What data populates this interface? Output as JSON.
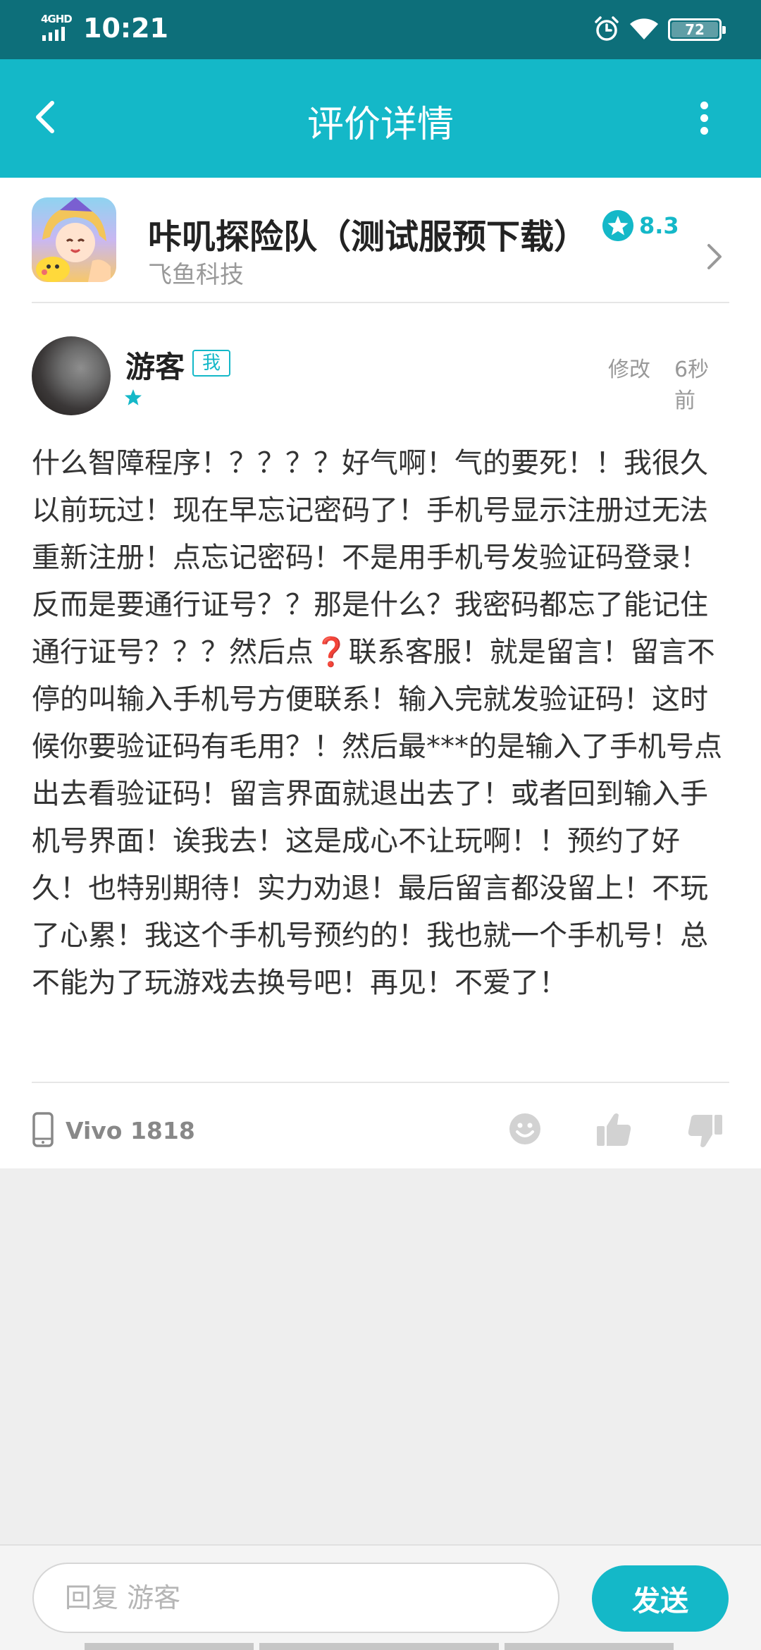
{
  "status_bar": {
    "network": "4GHD",
    "time": "10:21",
    "battery": "72"
  },
  "app_bar": {
    "title": "评价详情"
  },
  "game": {
    "name": "咔叽探险队（测试服预下载）",
    "developer": "飞鱼科技",
    "rating": "8.3"
  },
  "review": {
    "author": "游客",
    "author_badge": "我",
    "edit_label": "修改",
    "time_ago": "6秒前",
    "stars": 1,
    "text": "什么智障程序！？？？？好气啊！气的要死！！我很久以前玩过！现在早忘记密码了！手机号显示注册过无法重新注册！点忘记密码！不是用手机号发验证码登录！反而是要通行证号？？那是什么？我密码都忘了能记住通行证号？？？然后点❓联系客服！就是留言！留言不停的叫输入手机号方便联系！输入完就发验证码！这时候你要验证码有毛用？！然后最***的是输入了手机号点出去看验证码！留言界面就退出去了！或者回到输入手机号界面！诶我去！这是成心不让玩啊！！预约了好久！也特别期待！实力劝退！最后留言都没留上！不玩了心累！我这个手机号预约的！我也就一个手机号！总不能为了玩游戏去换号吧！再见！不爱了！",
    "device": "Vivo 1818"
  },
  "reply": {
    "placeholder": "回复 游客",
    "send_label": "发送"
  },
  "colors": {
    "accent": "#14b8c8",
    "status_bar": "#0d6f7a"
  }
}
